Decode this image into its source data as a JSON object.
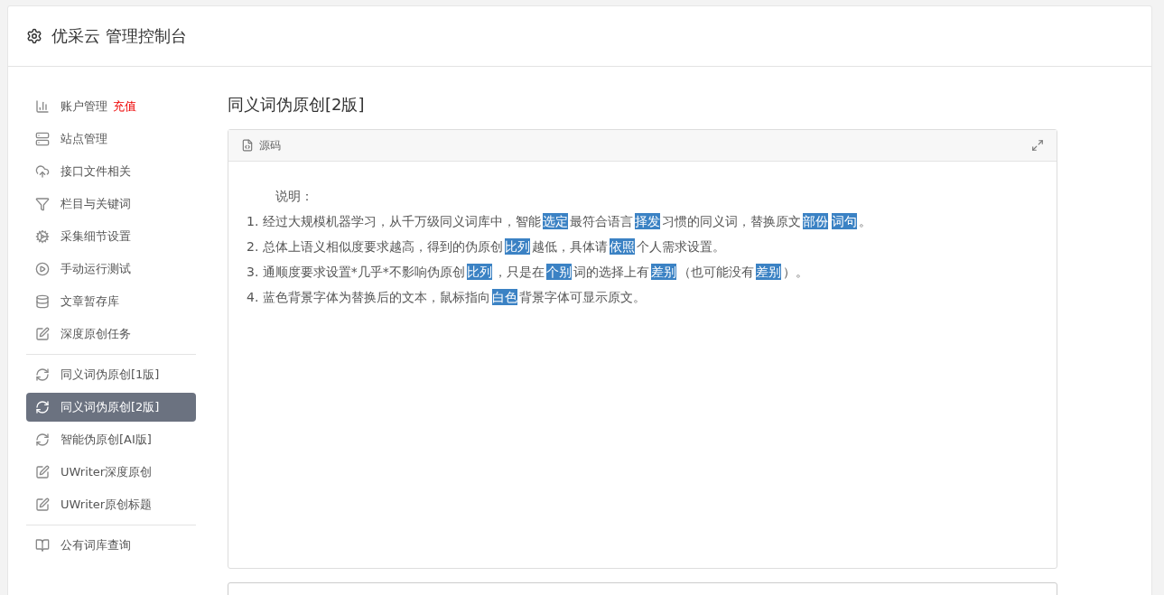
{
  "header": {
    "title": "优采云 管理控制台"
  },
  "sidebar": {
    "groups": [
      {
        "items": [
          {
            "label": "账户管理",
            "badge": "充值",
            "selected": false
          },
          {
            "label": "站点管理",
            "selected": false
          },
          {
            "label": "接口文件相关",
            "selected": false
          },
          {
            "label": "栏目与关键词",
            "selected": false
          },
          {
            "label": "采集细节设置",
            "selected": false
          },
          {
            "label": "手动运行测试",
            "selected": false
          },
          {
            "label": "文章暂存库",
            "selected": false
          },
          {
            "label": "深度原创任务",
            "selected": false
          }
        ]
      },
      {
        "items": [
          {
            "label": "同义词伪原创[1版]",
            "selected": false
          },
          {
            "label": "同义词伪原创[2版]",
            "selected": true
          },
          {
            "label": "智能伪原创[AI版]",
            "selected": false
          },
          {
            "label": "UWriter深度原创",
            "selected": false
          },
          {
            "label": "UWriter原创标题",
            "selected": false
          }
        ]
      },
      {
        "items": [
          {
            "label": "公有词库查询",
            "selected": false
          }
        ]
      }
    ]
  },
  "page_title": "同义词伪原创[2版]",
  "editor": {
    "tab": "源码",
    "heading": "说明：",
    "lines": [
      [
        {
          "text": "1. 经过大规模机器学习，从千万级同义词库中，智能",
          "highlighted": false
        },
        {
          "text": "选定",
          "highlighted": true
        },
        {
          "text": "最符合语言",
          "highlighted": false
        },
        {
          "text": "择发",
          "highlighted": true
        },
        {
          "text": "习惯的同义词，替换原文",
          "highlighted": false
        },
        {
          "text": "部份",
          "highlighted": true
        },
        {
          "text": "词句",
          "highlighted": true
        },
        {
          "text": "。",
          "highlighted": false
        }
      ],
      [
        {
          "text": "2. 总体上语义相似度要求越高，得到的伪原创",
          "highlighted": false
        },
        {
          "text": "比列",
          "highlighted": true
        },
        {
          "text": "越低，具体请",
          "highlighted": false
        },
        {
          "text": "依照",
          "highlighted": true
        },
        {
          "text": "个人需求设置。",
          "highlighted": false
        }
      ],
      [
        {
          "text": "3. 通顺度要求设置*几乎*不影响伪原创",
          "highlighted": false
        },
        {
          "text": "比列",
          "highlighted": true
        },
        {
          "text": "，只是在",
          "highlighted": false
        },
        {
          "text": "个别",
          "highlighted": true
        },
        {
          "text": "词的选择上有",
          "highlighted": false
        },
        {
          "text": "差别",
          "highlighted": true
        },
        {
          "text": "（也可能没有",
          "highlighted": false
        },
        {
          "text": "差别",
          "highlighted": true
        },
        {
          "text": "）。",
          "highlighted": false
        }
      ],
      [
        {
          "text": "4. 蓝色背景字体为替换后的文本，鼠标指向",
          "highlighted": false
        },
        {
          "text": "白色",
          "highlighted": true
        },
        {
          "text": "背景字体可显示原文。",
          "highlighted": false
        }
      ]
    ]
  }
}
